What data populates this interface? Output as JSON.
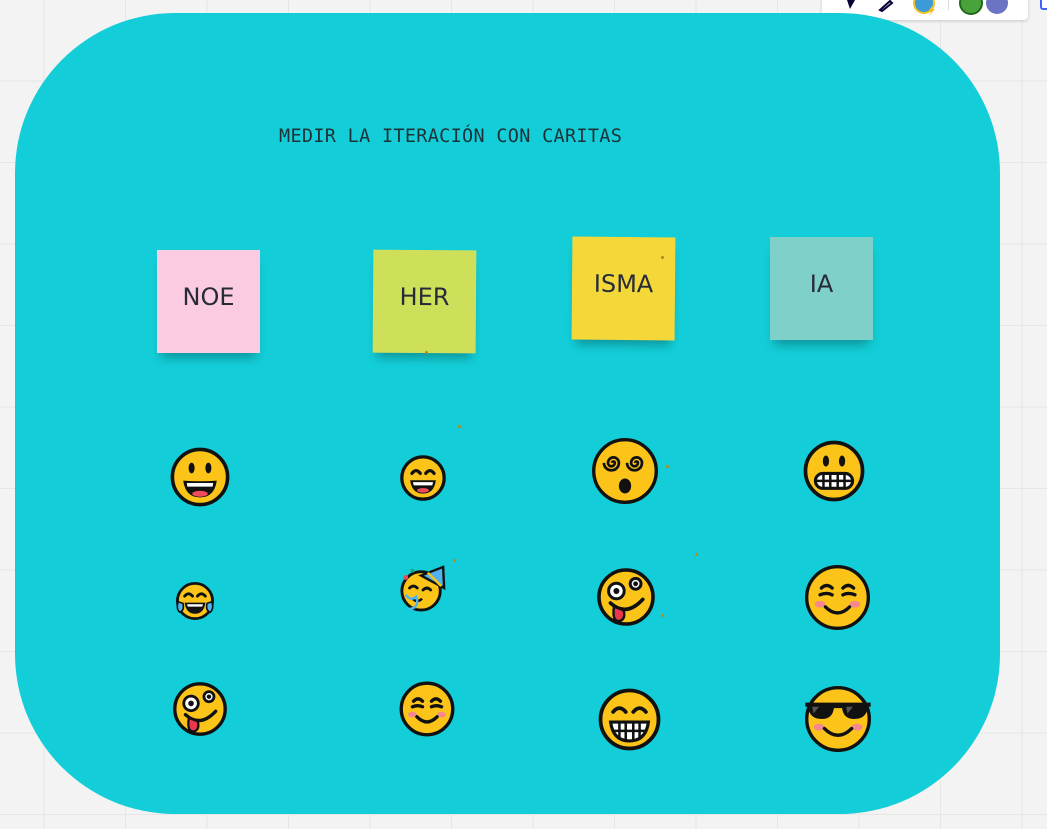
{
  "board": {
    "title": "MEDIR LA ITERACIÓN CON CARITAS",
    "background_color": "#13ced8"
  },
  "sticky_notes": [
    {
      "label": "NOE",
      "color": "#fbcce1"
    },
    {
      "label": "HER",
      "color": "#cee05a"
    },
    {
      "label": "ISMA",
      "color": "#f4d83a"
    },
    {
      "label": "IA",
      "color": "#7fd0c9"
    }
  ],
  "emoji_columns": [
    {
      "owner": "NOE",
      "emojis": [
        "grinning-face",
        "face-with-tears-of-joy",
        "zany-face"
      ]
    },
    {
      "owner": "HER",
      "emojis": [
        "grinning-face-with-smiling-eyes",
        "partying-face",
        "smiling-face-with-smiling-eyes"
      ]
    },
    {
      "owner": "ISMA",
      "emojis": [
        "face-with-spiral-eyes",
        "zany-face",
        "beaming-face-with-smiling-eyes"
      ]
    },
    {
      "owner": "IA",
      "emojis": [
        "grimacing-face",
        "smiling-face-with-smiling-eyes",
        "smiling-face-with-sunglasses"
      ]
    }
  ],
  "toolbar": {
    "icons": [
      "cursor-icon",
      "pen-icon",
      "user-avatar-icon",
      "user-avatar-icon",
      "user-avatar-icon"
    ]
  }
}
